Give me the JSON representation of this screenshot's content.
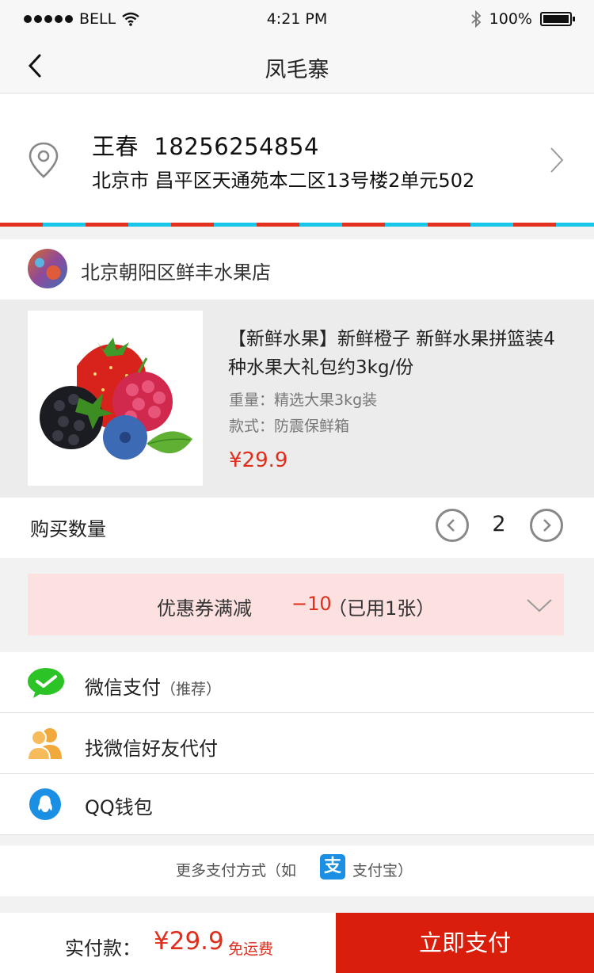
{
  "status_bar": {
    "carrier": "BELL",
    "time": "4:21 PM",
    "battery": "100%"
  },
  "nav": {
    "title": "凤毛寨"
  },
  "address": {
    "name_phone": "王春  18256254854",
    "detail": "北京市 昌平区天通苑本二区13号楼2单元502"
  },
  "shop": {
    "name": "北京朝阳区鲜丰水果店"
  },
  "product": {
    "title": "【新鲜水果】新鲜橙子 新鲜水果拼篮装4种水果大礼包约3kg/份",
    "weight": "重量：精选大果3kg装",
    "style": "款式：防震保鲜箱",
    "price": "¥29.9"
  },
  "quantity": {
    "label": "购买数量",
    "value": "2"
  },
  "coupon": {
    "label": "优惠券满减",
    "value": "−10",
    "used": "（已用1张）"
  },
  "payment": {
    "wechat": {
      "label": "微信支付",
      "sub": "（推荐）"
    },
    "friend": {
      "label": "找微信好友代付"
    },
    "qq": {
      "label": "QQ钱包"
    },
    "more_prefix": "更多支付方式（如",
    "more_suffix": "支付宝）",
    "alipay_glyph": "支"
  },
  "footer": {
    "total_label": "实付款：",
    "total_price": "¥29.9",
    "shipping_note": "免运费",
    "pay_button": "立即支付"
  },
  "colors": {
    "accent_red": "#d91e0b",
    "price_red": "#e02e1c",
    "stripe_blue": "#18c6ea",
    "wechat_green": "#2bc325",
    "qq_blue": "#1a8fe3",
    "friend_orange": "#f2a93b"
  }
}
